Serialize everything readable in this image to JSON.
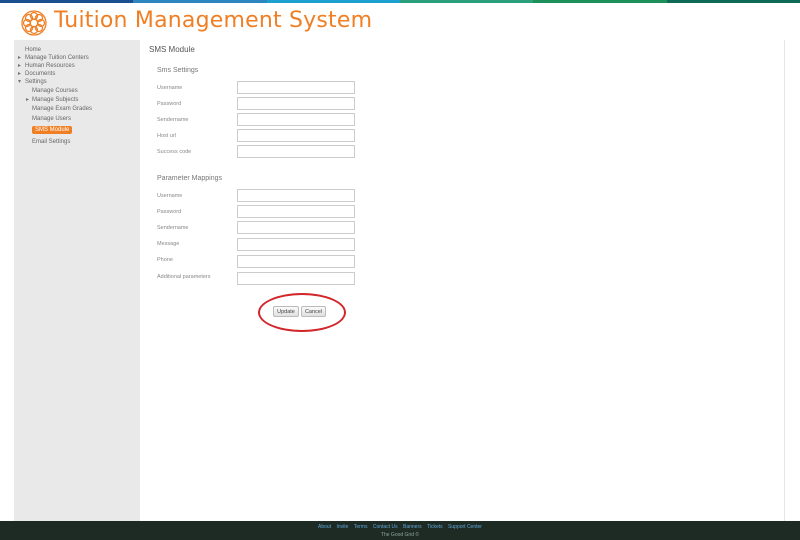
{
  "colors": {
    "brand": "#f07f24",
    "topbar": [
      "#1a4f8f",
      "#2e86c1",
      "#2aa07a",
      "#1d8f5a",
      "#1a7a4a"
    ],
    "footer_bg": "#1e2a24",
    "highlight": "#d2262a"
  },
  "header": {
    "title": "Tuition Management System",
    "logo_icon": "flower-logo-icon"
  },
  "sidebar": {
    "items": [
      {
        "label": "Home"
      },
      {
        "label": "Manage Tuition Centers"
      },
      {
        "label": "Human Resources"
      },
      {
        "label": "Documents"
      },
      {
        "label": "Settings"
      }
    ],
    "subitems": [
      {
        "label": "Manage Courses"
      },
      {
        "label": "Manage Subjects"
      },
      {
        "label": "Manage Exam Grades"
      },
      {
        "label": "Manage Users"
      },
      {
        "label": "SMS Module"
      },
      {
        "label": "Email Settings"
      }
    ]
  },
  "main": {
    "title": "SMS Module",
    "sms_settings": {
      "heading": "Sms Settings",
      "fields": [
        {
          "label": "Username",
          "value": ""
        },
        {
          "label": "Password",
          "value": ""
        },
        {
          "label": "Sendername",
          "value": ""
        },
        {
          "label": "Host url",
          "value": ""
        },
        {
          "label": "Success code",
          "value": ""
        }
      ]
    },
    "parameter_mappings": {
      "heading": "Parameter Mappings",
      "fields": [
        {
          "label": "Username",
          "value": ""
        },
        {
          "label": "Password",
          "value": ""
        },
        {
          "label": "Sendername",
          "value": ""
        },
        {
          "label": "Message",
          "value": ""
        },
        {
          "label": "Phone",
          "value": ""
        },
        {
          "label": "Additional parameters",
          "value": ""
        }
      ]
    },
    "buttons": {
      "update": "Update",
      "cancel": "Cancel"
    }
  },
  "footer": {
    "links": [
      "About",
      "Invite",
      "Terms",
      "Contact Us",
      "Banners",
      "Tickets",
      "Support Center"
    ],
    "copyright": "The Good Grid ©"
  }
}
